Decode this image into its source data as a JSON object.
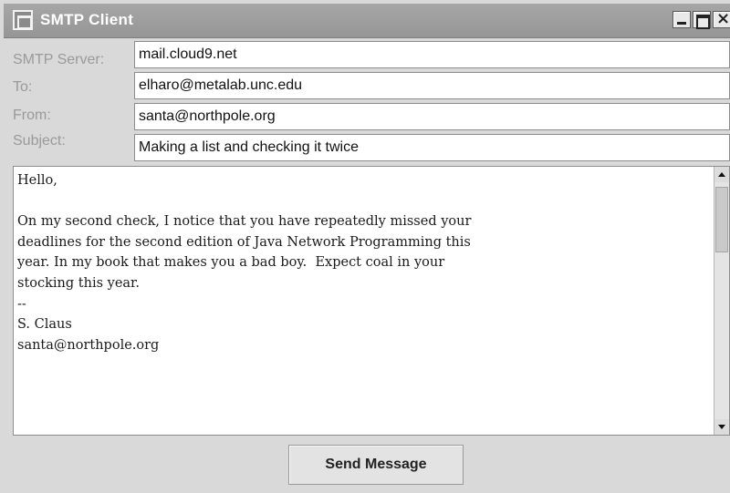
{
  "window": {
    "title": "SMTP Client",
    "minimize_icon": "minimize-icon",
    "maximize_icon": "maximize-icon",
    "close_glyph": "×"
  },
  "form": {
    "server_label": "SMTP Server:",
    "server_value": "mail.cloud9.net",
    "to_label": "To:",
    "to_value": "elharo@metalab.unc.edu",
    "from_label": "From:",
    "from_value": "santa@northpole.org",
    "subject_label": "Subject:",
    "subject_value": "Making a list and checking it twice"
  },
  "message": {
    "body": "Hello,\n\nOn my second check, I notice that you have repeatedly missed your\ndeadlines for the second edition of Java Network Programming this\nyear. In my book that makes you a bad boy.  Expect coal in your\nstocking this year.\n--\nS. Claus\nsanta@northpole.org"
  },
  "actions": {
    "send_label": "Send Message"
  }
}
